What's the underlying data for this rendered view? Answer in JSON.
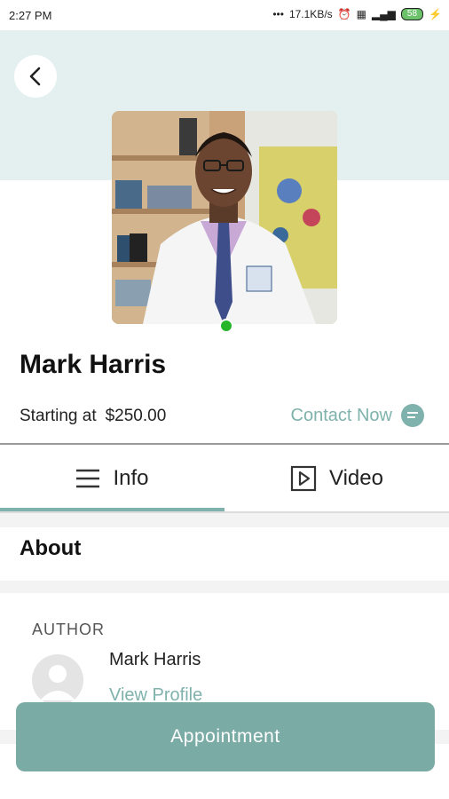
{
  "status_bar": {
    "time": "2:27 PM",
    "speed": "17.1KB/s",
    "battery": "58"
  },
  "profile": {
    "name": "Mark Harris",
    "starting_label": "Starting at",
    "price": "$250.00",
    "contact_label": "Contact Now"
  },
  "tabs": [
    {
      "label": "Info",
      "icon": "menu-icon"
    },
    {
      "label": "Video",
      "icon": "play-icon"
    }
  ],
  "about": {
    "heading": "About"
  },
  "author": {
    "label": "AUTHOR",
    "name": "Mark Harris",
    "link": "View Profile"
  },
  "actions": {
    "appointment_label": "Appointment"
  },
  "colors": {
    "accent": "#7fb2ac",
    "header_bg": "#e3f0ef",
    "online": "#27b52a"
  }
}
